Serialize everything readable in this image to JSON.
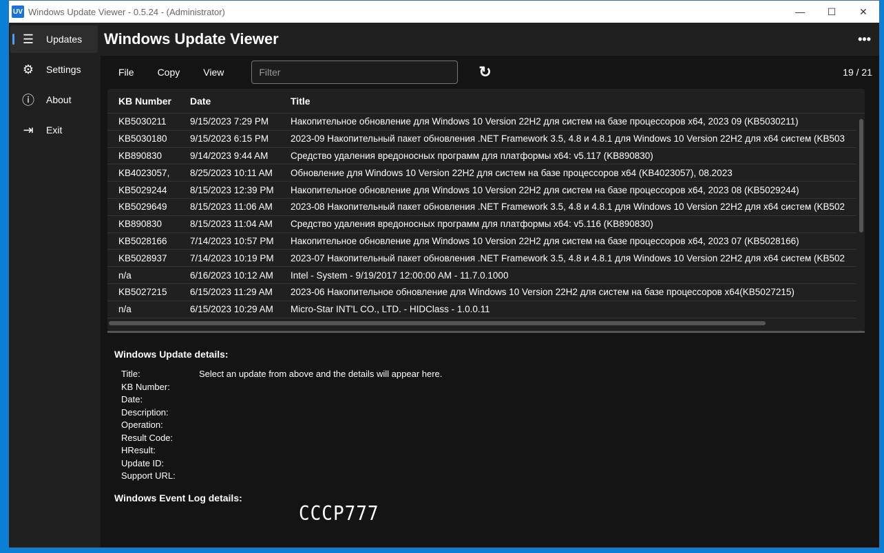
{
  "window": {
    "title": "Windows Update Viewer - 0.5.24 - (Administrator)",
    "logo": "UV",
    "controls": [
      "minimize-icon",
      "maximize-icon",
      "close-icon"
    ]
  },
  "sidebar": {
    "items": [
      {
        "label": "Updates",
        "icon": "list-icon"
      },
      {
        "label": "Settings",
        "icon": "gear-icon"
      },
      {
        "label": "About",
        "icon": "info-icon"
      },
      {
        "label": "Exit",
        "icon": "exit-icon"
      }
    ]
  },
  "header": {
    "title": "Windows Update Viewer",
    "more": "•••"
  },
  "toolbar": {
    "file": "File",
    "copy": "Copy",
    "view": "View",
    "filter_placeholder": "Filter",
    "filter_value": "",
    "refresh": "↻",
    "count": "19 / 21"
  },
  "table": {
    "headers": [
      "KB Number",
      "Date",
      "Title"
    ],
    "rows": [
      [
        "KB5030211",
        "9/15/2023  7:29 PM",
        "Накопительное обновление для Windows 10 Version 22H2 для систем на базе процессоров x64, 2023 09 (KB5030211)"
      ],
      [
        "KB5030180",
        "9/15/2023  6:15 PM",
        "2023-09 Накопительный пакет обновления .NET Framework 3.5, 4.8 и 4.8.1 для Windows 10 Version 22H2 для x64 систем (KB503"
      ],
      [
        "KB890830",
        "9/14/2023  9:44 AM",
        "Средство удаления вредоносных программ для платформы x64: v5.117 (KB890830)"
      ],
      [
        "KB4023057,",
        "8/25/2023  10:11 AM",
        "Обновление для Windows 10 Version 22H2 для систем на базе процессоров x64 (KB4023057), 08.2023"
      ],
      [
        "KB5029244",
        "8/15/2023  12:39 PM",
        "Накопительное обновление для Windows 10 Version 22H2 для систем на базе процессоров x64, 2023 08 (KB5029244)"
      ],
      [
        "KB5029649",
        "8/15/2023  11:06 AM",
        "2023-08 Накопительный пакет обновления .NET Framework 3.5, 4.8 и 4.8.1 для Windows 10 Version 22H2 для x64 систем (KB502"
      ],
      [
        "KB890830",
        "8/15/2023  11:04 AM",
        "Средство удаления вредоносных программ для платформы x64: v5.116 (KB890830)"
      ],
      [
        "KB5028166",
        "7/14/2023  10:57 PM",
        "Накопительное обновление для Windows 10 Version 22H2 для систем на базе процессоров x64, 2023 07 (KB5028166)"
      ],
      [
        "KB5028937",
        "7/14/2023  10:19 PM",
        "2023-07 Накопительный пакет обновления .NET Framework 3.5, 4.8 и 4.8.1 для Windows 10 Version 22H2 для x64 систем (KB502"
      ],
      [
        "n/a",
        "6/16/2023  10:12 AM",
        "Intel - System - 9/19/2017 12:00:00 AM - 11.7.0.1000"
      ],
      [
        "KB5027215",
        "6/15/2023  11:29 AM",
        "2023-06 Накопительное обновление для Windows 10 Version 22H2 для систем на базе процессоров x64(KB5027215)"
      ],
      [
        "n/a",
        "6/15/2023  10:29 AM",
        "Micro-Star INT'L CO., LTD. - HIDClass - 1.0.0.11"
      ]
    ]
  },
  "details": {
    "heading": "Windows Update details:",
    "fields": [
      {
        "label": "Title:",
        "value": "Select an update from above and the details will appear here."
      },
      {
        "label": "KB Number:",
        "value": ""
      },
      {
        "label": "Date:",
        "value": ""
      },
      {
        "label": "Description:",
        "value": ""
      },
      {
        "label": "Operation:",
        "value": ""
      },
      {
        "label": "Result Code:",
        "value": ""
      },
      {
        "label": "HResult:",
        "value": ""
      },
      {
        "label": "Update ID:",
        "value": ""
      },
      {
        "label": "Support URL:",
        "value": ""
      }
    ],
    "event_heading": "Windows Event Log details:"
  },
  "watermark": "CCCP777"
}
